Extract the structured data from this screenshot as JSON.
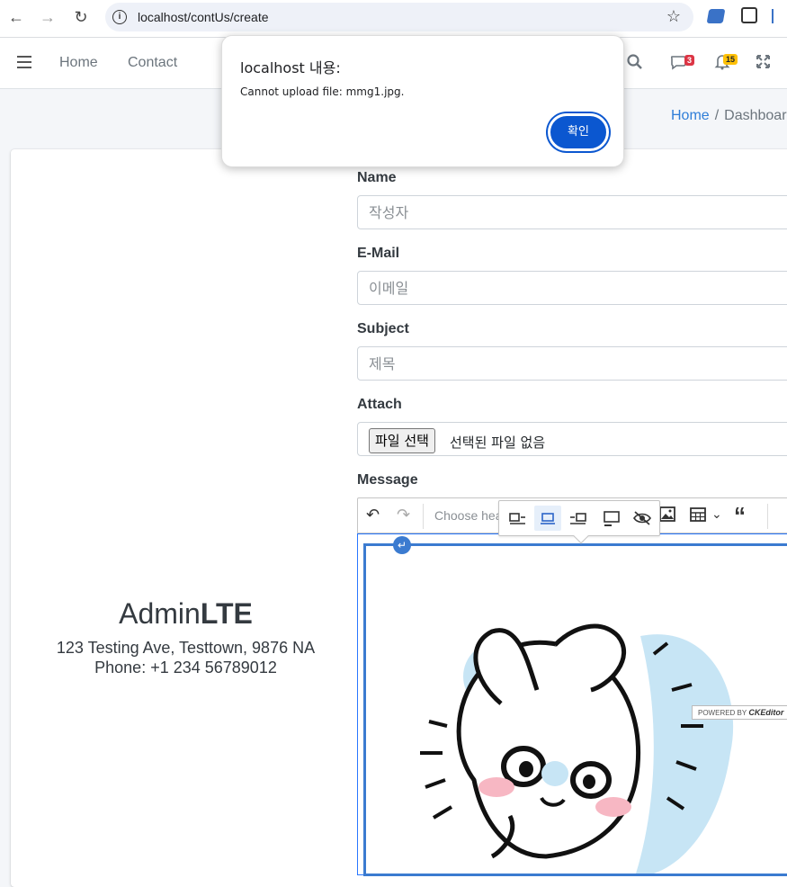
{
  "browser": {
    "url": "localhost/contUs/create",
    "back_icon": "←",
    "forward_icon": "→",
    "reload_icon": "↻",
    "info_icon": "i",
    "star_icon": "☆"
  },
  "navbar": {
    "menu_icon": "hamburger",
    "links": [
      "Home",
      "Contact"
    ],
    "messages_count": "3",
    "notifications_count": "15",
    "search_icon": "⌕",
    "messages_icon": "✉",
    "bell_icon": "⍾",
    "fullscreen_icon": "⤢"
  },
  "breadcrumb": {
    "home": "Home",
    "separator": "/",
    "current": "Dashboard"
  },
  "contact": {
    "brand_prefix": "Admin",
    "brand_bold": "LTE",
    "address": "123 Testing Ave, Testtown, 9876 NA",
    "phone": "Phone: +1 234 56789012"
  },
  "form": {
    "name_label": "Name",
    "name_placeholder": "작성자",
    "email_label": "E-Mail",
    "email_placeholder": "이메일",
    "subject_label": "Subject",
    "subject_placeholder": "제목",
    "attach_label": "Attach",
    "file_button": "파일 선택",
    "file_status": "선택된 파일 없음",
    "message_label": "Message"
  },
  "editor": {
    "heading_placeholder": "Choose hea",
    "undo_icon": "↶",
    "redo_icon": "↷",
    "image_icon": "▣",
    "table_icon": "▦",
    "table_dropdown_icon": "⌄",
    "quote_icon": "“",
    "more_icon": "⋮",
    "return_icon": "↵",
    "powered_prefix": "POWERED BY",
    "powered_brand": "CKEditor"
  },
  "dialog": {
    "title": "localhost 내용:",
    "message": "Cannot upload file: mmg1.jpg.",
    "ok_label": "확인"
  },
  "colors": {
    "accent": "#0b57d0",
    "link": "#2f7ed8",
    "messages_badge": "#dc3545",
    "notifications_badge": "#ffc107"
  }
}
